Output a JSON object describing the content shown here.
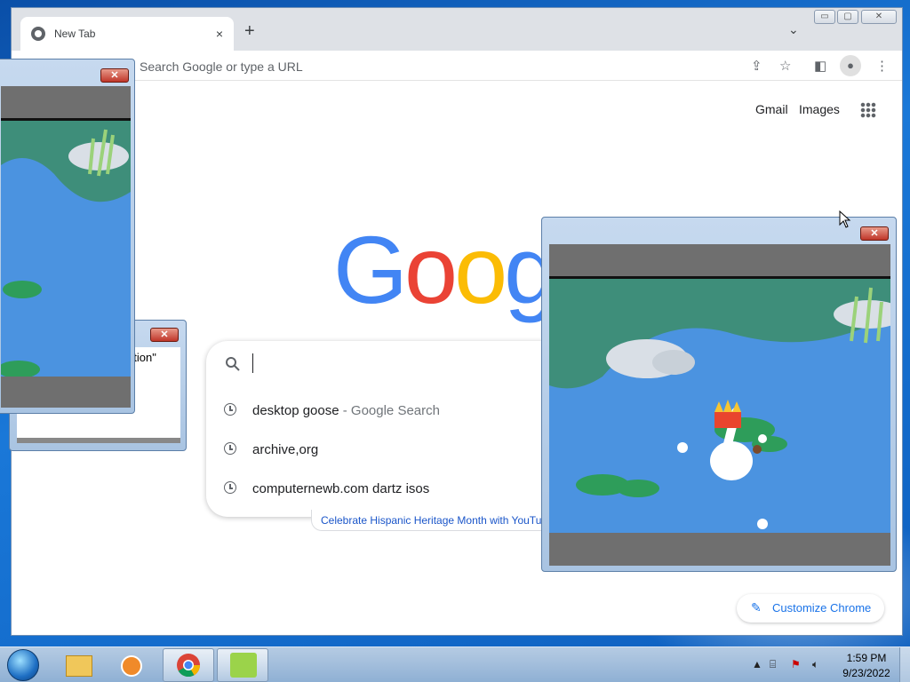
{
  "browser": {
    "tab_title": "New Tab",
    "tab_close": "×",
    "new_tab": "+",
    "tab_search": "⌄",
    "window_buttons": [
      "▭",
      "▢",
      "✕"
    ],
    "omnibox_placeholder": "Search Google or type a URL",
    "ntp_links": [
      "Gmail",
      "Images"
    ],
    "logo": "Google",
    "logo_colors": [
      "#4285f4",
      "#ea4335",
      "#fbbc05",
      "#4285f4",
      "#34a853",
      "#ea4335"
    ],
    "search_value": "",
    "suggestions": [
      {
        "query": "desktop goose",
        "suffix": " - Google Search"
      },
      {
        "query": "archive,org",
        "suffix": ""
      },
      {
        "query": "computernewb.com dartz isos",
        "suffix": ""
      }
    ],
    "doodle_text": "Celebrate Hispanic Heritage Month with YouTub",
    "customize_label": "Customize Chrome"
  },
  "popups": {
    "close_glyph": "✕",
    "partial_text": "ption\""
  },
  "taskbar": {
    "time": "1:59 PM",
    "date": "9/23/2022",
    "apps": [
      "explorer",
      "media-player",
      "chrome",
      "desktop-goose"
    ]
  }
}
